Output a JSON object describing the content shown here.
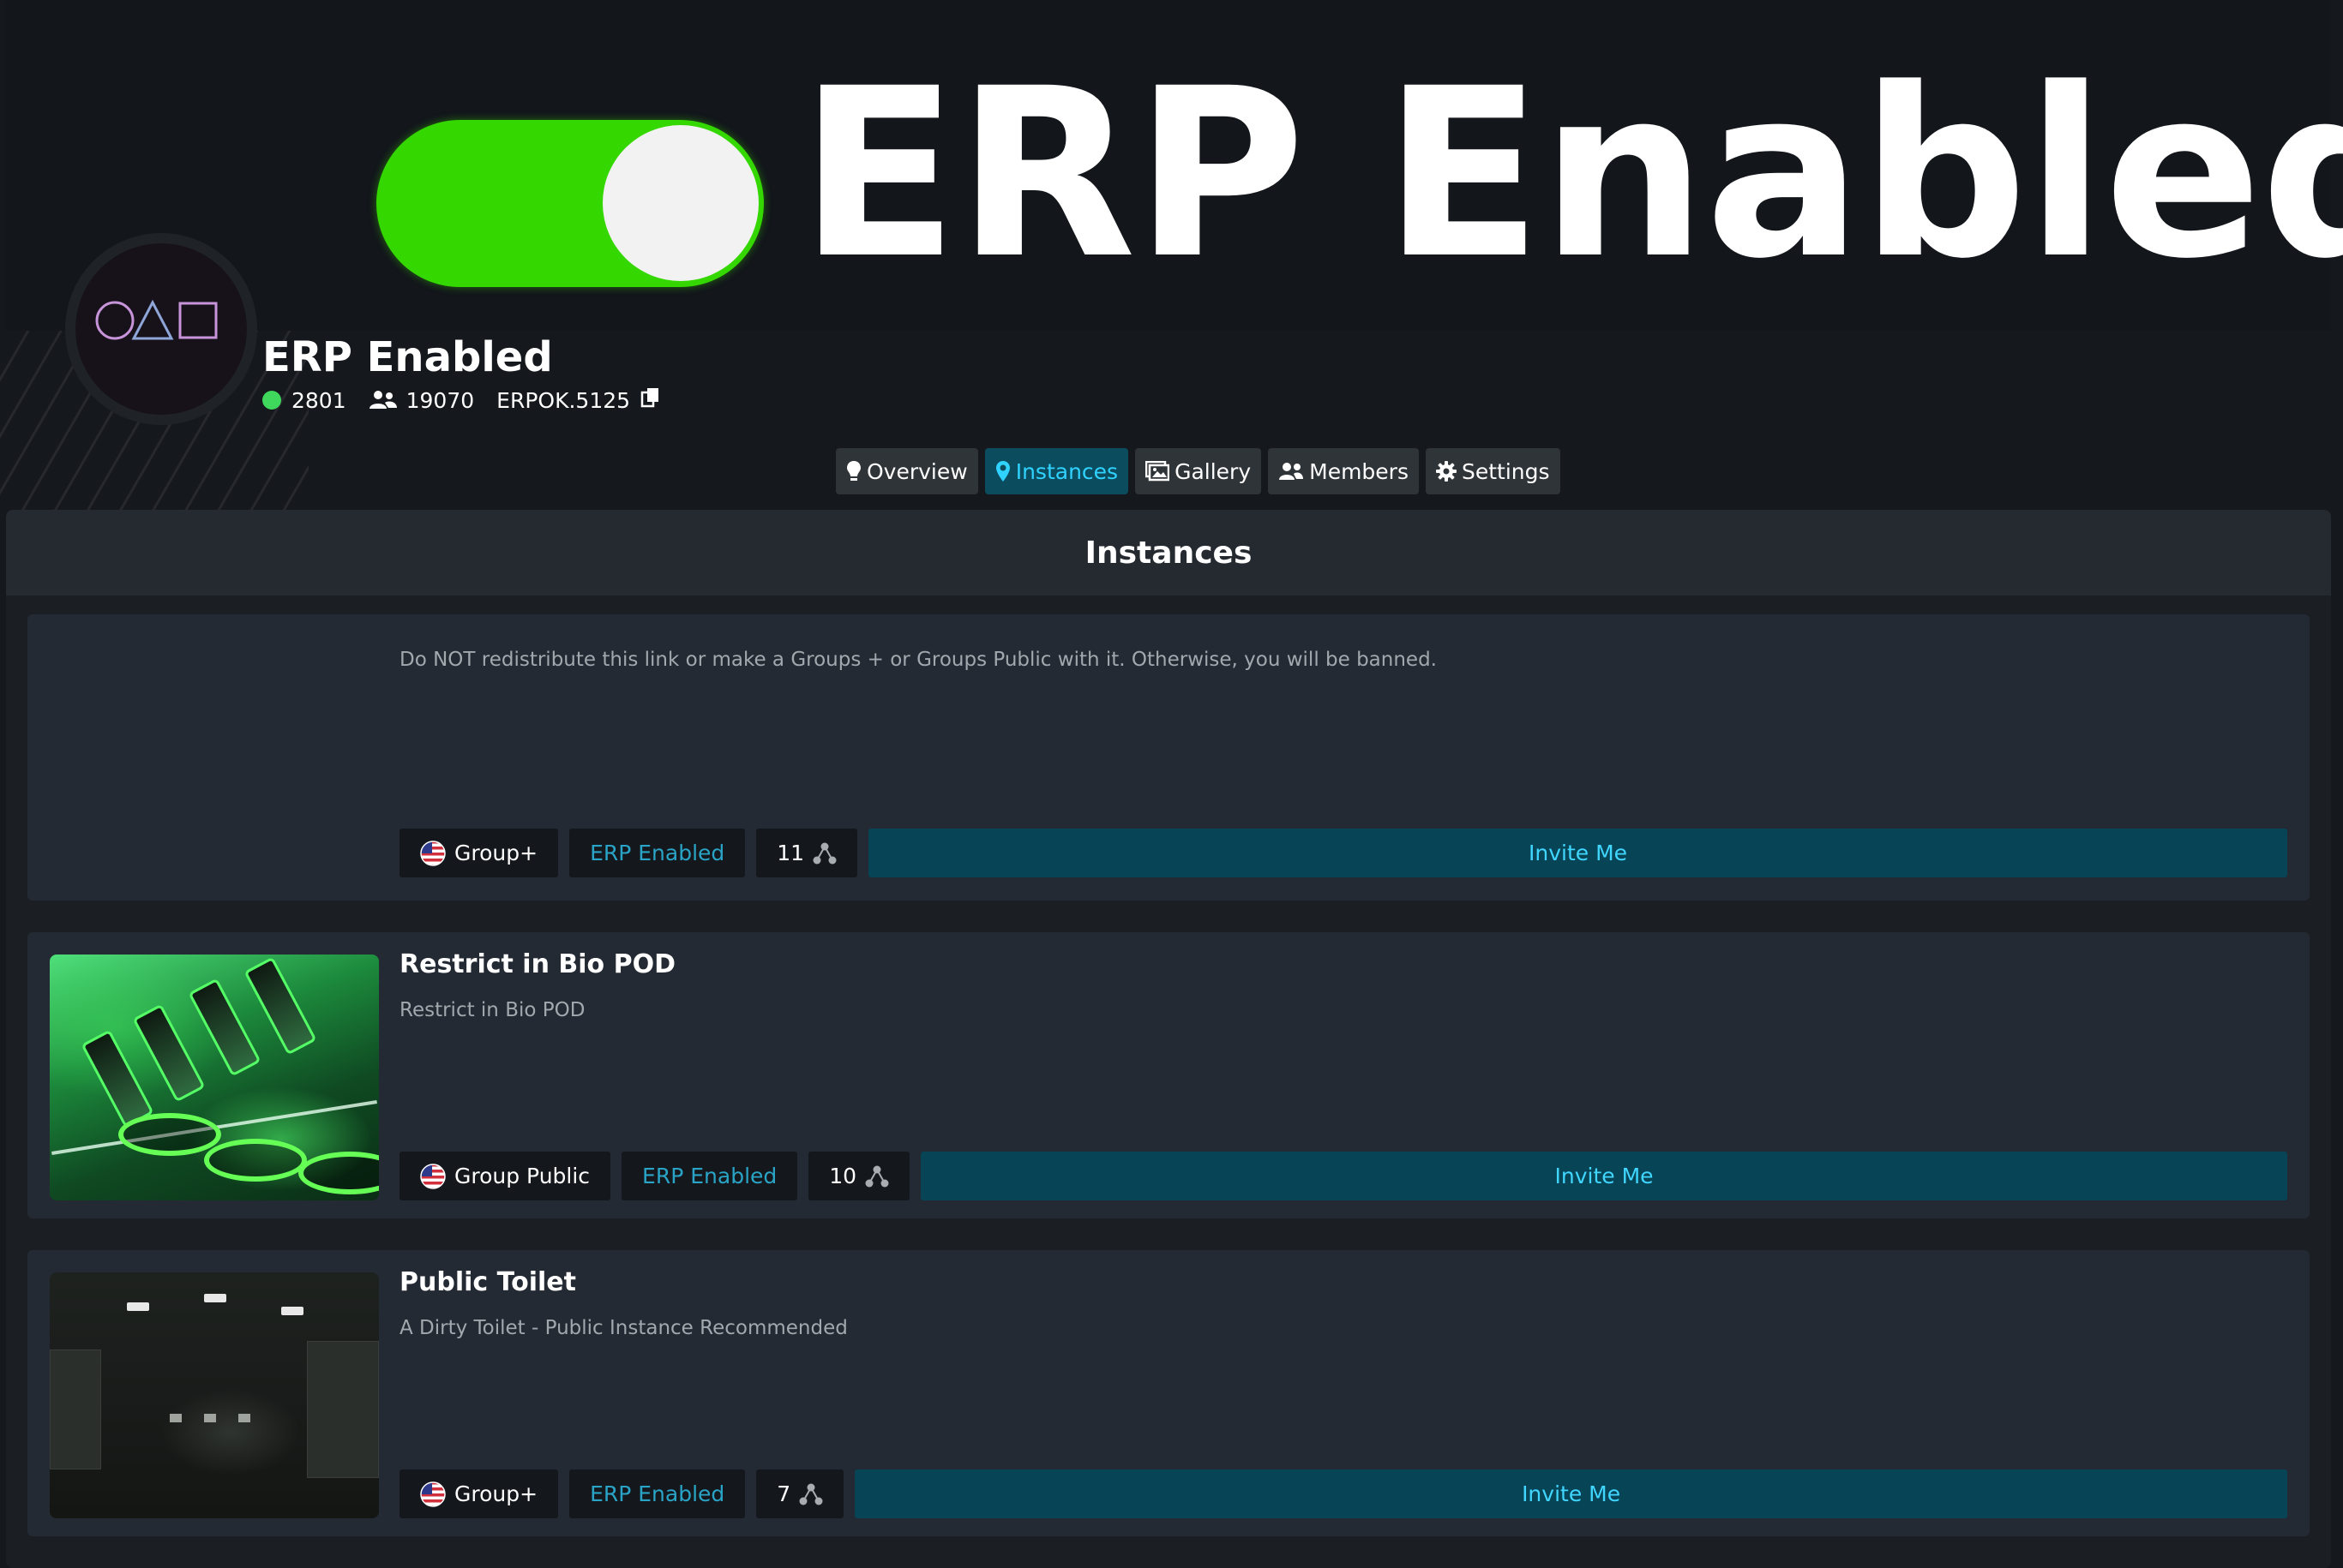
{
  "banner": {
    "text": "ERP Enabled",
    "toggle_color": "#35d700"
  },
  "group": {
    "name": "ERP Enabled",
    "online_count": "2801",
    "member_count": "19070",
    "short_code": "ERPOK.5125",
    "online_color": "#3fd85c"
  },
  "tabs": [
    {
      "label": "Overview",
      "icon": "lightbulb-icon",
      "active": false
    },
    {
      "label": "Instances",
      "icon": "map-pin-icon",
      "active": true
    },
    {
      "label": "Gallery",
      "icon": "images-icon",
      "active": false
    },
    {
      "label": "Members",
      "icon": "users-icon",
      "active": false
    },
    {
      "label": "Settings",
      "icon": "gear-icon",
      "active": false
    }
  ],
  "section": {
    "title": "Instances"
  },
  "instances": [
    {
      "name": "",
      "description": "Do NOT redistribute this link or make a Groups + or Groups Public with it. Otherwise, you will be banned.",
      "access": "Group+",
      "region_icon": "us-flag-icon",
      "tag": "ERP Enabled",
      "user_count": "11",
      "invite_label": "Invite Me"
    },
    {
      "name": "Restrict in Bio POD",
      "description": "Restrict in Bio POD",
      "access": "Group Public",
      "region_icon": "us-flag-icon",
      "tag": "ERP Enabled",
      "user_count": "10",
      "invite_label": "Invite Me"
    },
    {
      "name": "Public Toilet",
      "description": "A Dirty Toilet - Public Instance Recommended",
      "access": "Group+",
      "region_icon": "us-flag-icon",
      "tag": "ERP Enabled",
      "user_count": "7",
      "invite_label": "Invite Me"
    }
  ],
  "colors": {
    "active_tab_bg": "#0b4d5e",
    "active_tab_text": "#30d2ff",
    "invite_bg": "#064456",
    "invite_text": "#40d6ff",
    "tag_text": "#2aa4c6"
  }
}
